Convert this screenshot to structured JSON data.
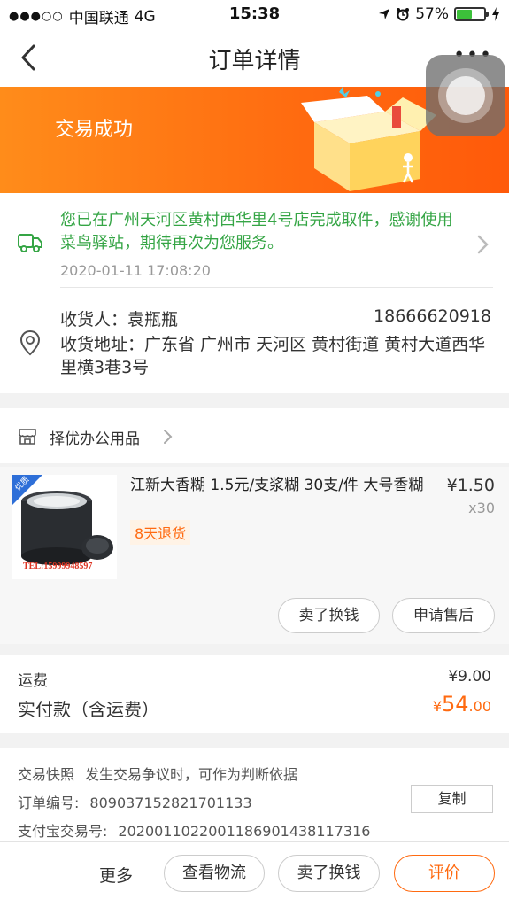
{
  "status_bar": {
    "carrier": "中国联通",
    "network": "4G",
    "time": "15:38",
    "battery": "57%",
    "battery_level": 0.57
  },
  "nav": {
    "title": "订单详情",
    "back_icon": "chevron-left-icon",
    "more_icon": "more-icon"
  },
  "banner": {
    "status": "交易成功",
    "background_color": "#ff7a14"
  },
  "pickup": {
    "message": "您已在广州天河区黄村西华里4号店完成取件，感谢使用菜鸟驿站，期待再次为您服务。",
    "time": "2020-01-11 17:08:20",
    "color": "#35a545"
  },
  "receiver": {
    "name_label": "收货人：",
    "name": "袁瓶瓶",
    "phone": "18666620918",
    "address_label": "收货地址：",
    "address": "广东省 广州市 天河区 黄村街道 黄村大道西华里横3巷3号"
  },
  "shop": {
    "name": "择优办公用品",
    "icon": "store-icon"
  },
  "product": {
    "title": "江新大香糊 1.5元/支浆糊 30支/件 大号香糊",
    "price": "¥1.50",
    "quantity": "x30",
    "refund_tag": "8天退货",
    "thumb_badge": "优质",
    "thumb_caption": "TEL:15999948597",
    "buttons": [
      "卖了换钱",
      "申请售后"
    ]
  },
  "fees": {
    "shipping_label": "运费",
    "shipping_value": "¥9.00",
    "paid_label": "实付款（含运费）",
    "paid_currency": "¥",
    "paid_int": "54",
    "paid_dec": ".00"
  },
  "order_info": {
    "snapshot_label": "交易快照",
    "snapshot_desc": "发生交易争议时，可作为判断依据",
    "order_no_label": "订单编号:",
    "order_no": "809037152821701133",
    "alipay_label": "支付宝交易号:",
    "alipay_no": "2020011022001186901438117316",
    "copy_label": "复制"
  },
  "bottom_bar": {
    "more": "更多",
    "logistics": "查看物流",
    "sell": "卖了换钱",
    "review": "评价"
  },
  "colors": {
    "accent": "#ff6a10",
    "green": "#35a545"
  }
}
